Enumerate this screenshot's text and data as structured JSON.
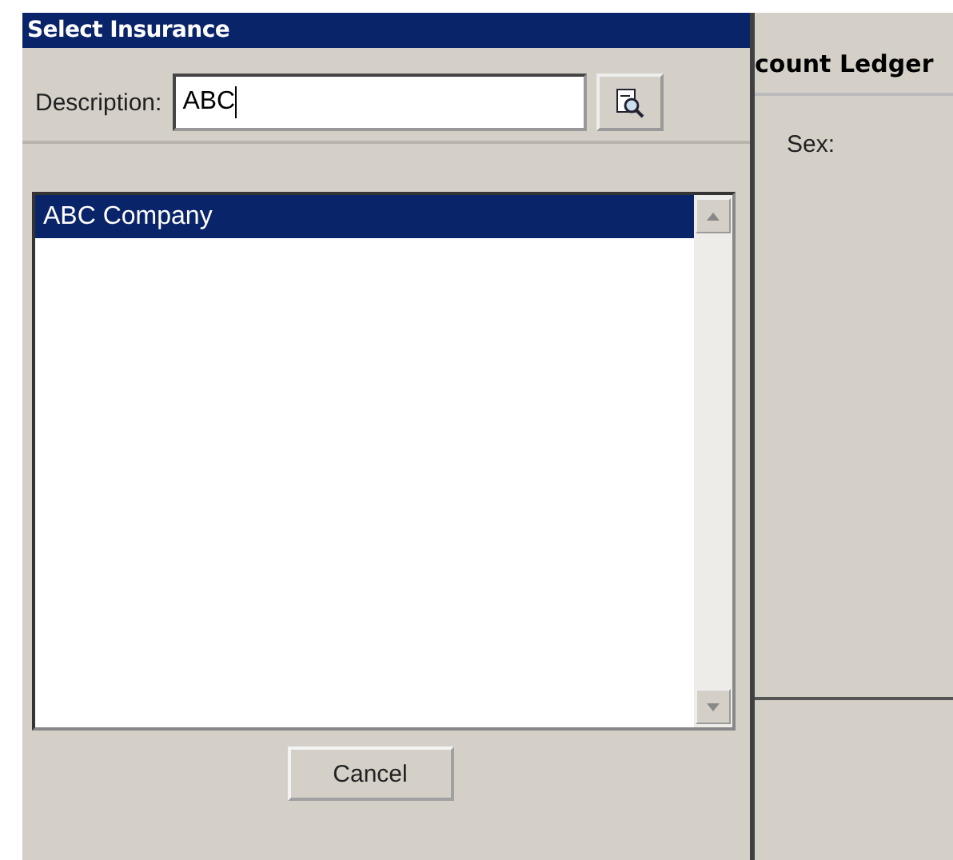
{
  "dialog": {
    "title": "Select Insurance",
    "description_label": "Description:",
    "description_value": "ABC",
    "results": [
      {
        "label": "ABC Company",
        "selected": true
      }
    ],
    "cancel_button": {
      "label": "Cancel"
    }
  },
  "background_window": {
    "header": {
      "label": "count Ledger"
    },
    "sex_label": "Sex:"
  }
}
